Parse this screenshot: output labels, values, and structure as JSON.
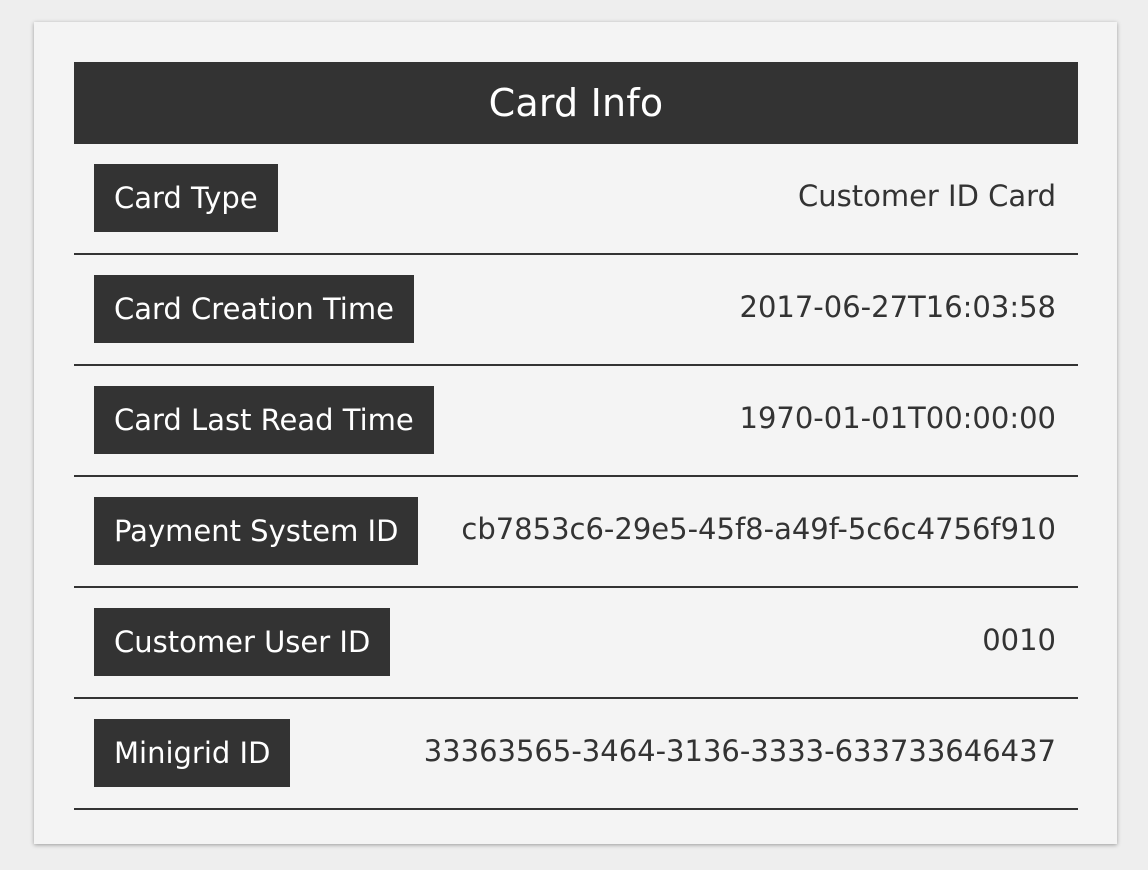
{
  "card": {
    "title": "Card Info",
    "rows": [
      {
        "label": "Card Type",
        "value": "Customer ID Card"
      },
      {
        "label": "Card Creation Time",
        "value": "2017-06-27T16:03:58"
      },
      {
        "label": "Card Last Read Time",
        "value": "1970-01-01T00:00:00"
      },
      {
        "label": "Payment System ID",
        "value": "cb7853c6-29e5-45f8-a49f-5c6c4756f910"
      },
      {
        "label": "Customer User ID",
        "value": "0010"
      },
      {
        "label": "Minigrid ID",
        "value": "33363565-3464-3136-3333-633733646437"
      }
    ]
  },
  "colors": {
    "header_bg": "#333333",
    "header_text": "#ffffff",
    "panel_bg": "#f4f4f4",
    "page_bg": "#eeeeee",
    "value_text": "#333333"
  }
}
